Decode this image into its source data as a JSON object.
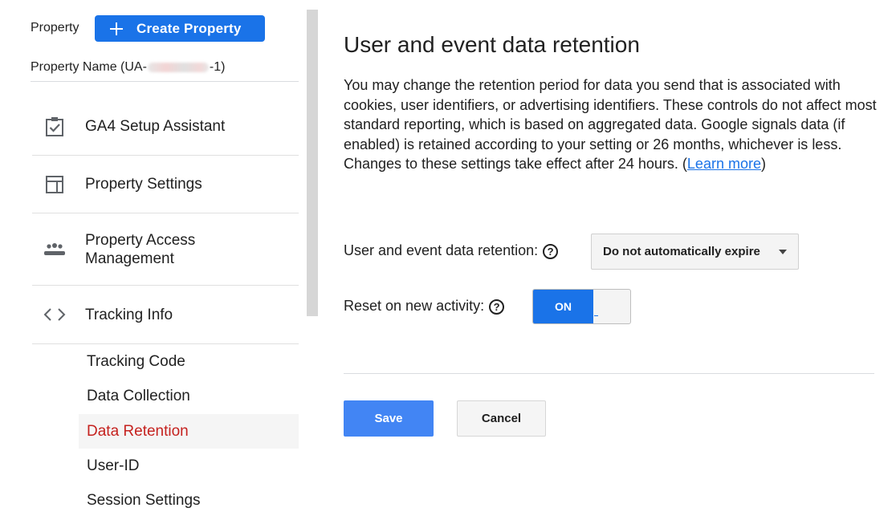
{
  "sidebar": {
    "property_label": "Property",
    "create_button_label": "Create Property",
    "property_name_prefix": "Property Name (UA-",
    "property_name_suffix": "-1)",
    "nav_items": [
      {
        "label": "GA4 Setup Assistant",
        "icon": "clipboard-check-icon"
      },
      {
        "label": "Property Settings",
        "icon": "layout-panel-icon"
      },
      {
        "label": "Property Access Management",
        "icon": "people-group-icon"
      },
      {
        "label": "Tracking Info",
        "icon": "code-brackets-icon"
      }
    ],
    "sub_items": [
      {
        "label": "Tracking Code"
      },
      {
        "label": "Data Collection"
      },
      {
        "label": "Data Retention",
        "active": true
      },
      {
        "label": "User-ID"
      },
      {
        "label": "Session Settings"
      }
    ]
  },
  "main": {
    "title": "User and event data retention",
    "description": "You may change the retention period for data you send that is associated with cookies, user identifiers, or advertising identifiers. These controls do not affect most standard reporting, which is based on aggregated data. Google signals data (if enabled) is retained according to your setting or 26 months, whichever is less. Changes to these settings take effect after 24 hours. (",
    "learn_more": "Learn more",
    "description_end": ")",
    "retention_label": "User and event data retention:",
    "retention_value": "Do not automatically expire",
    "reset_label": "Reset on new activity:",
    "reset_state": "ON",
    "help_glyph": "?",
    "save_label": "Save",
    "cancel_label": "Cancel"
  },
  "colors": {
    "accent": "#1a73e8",
    "save_button": "#4285f4",
    "active_item": "#c5221f"
  }
}
